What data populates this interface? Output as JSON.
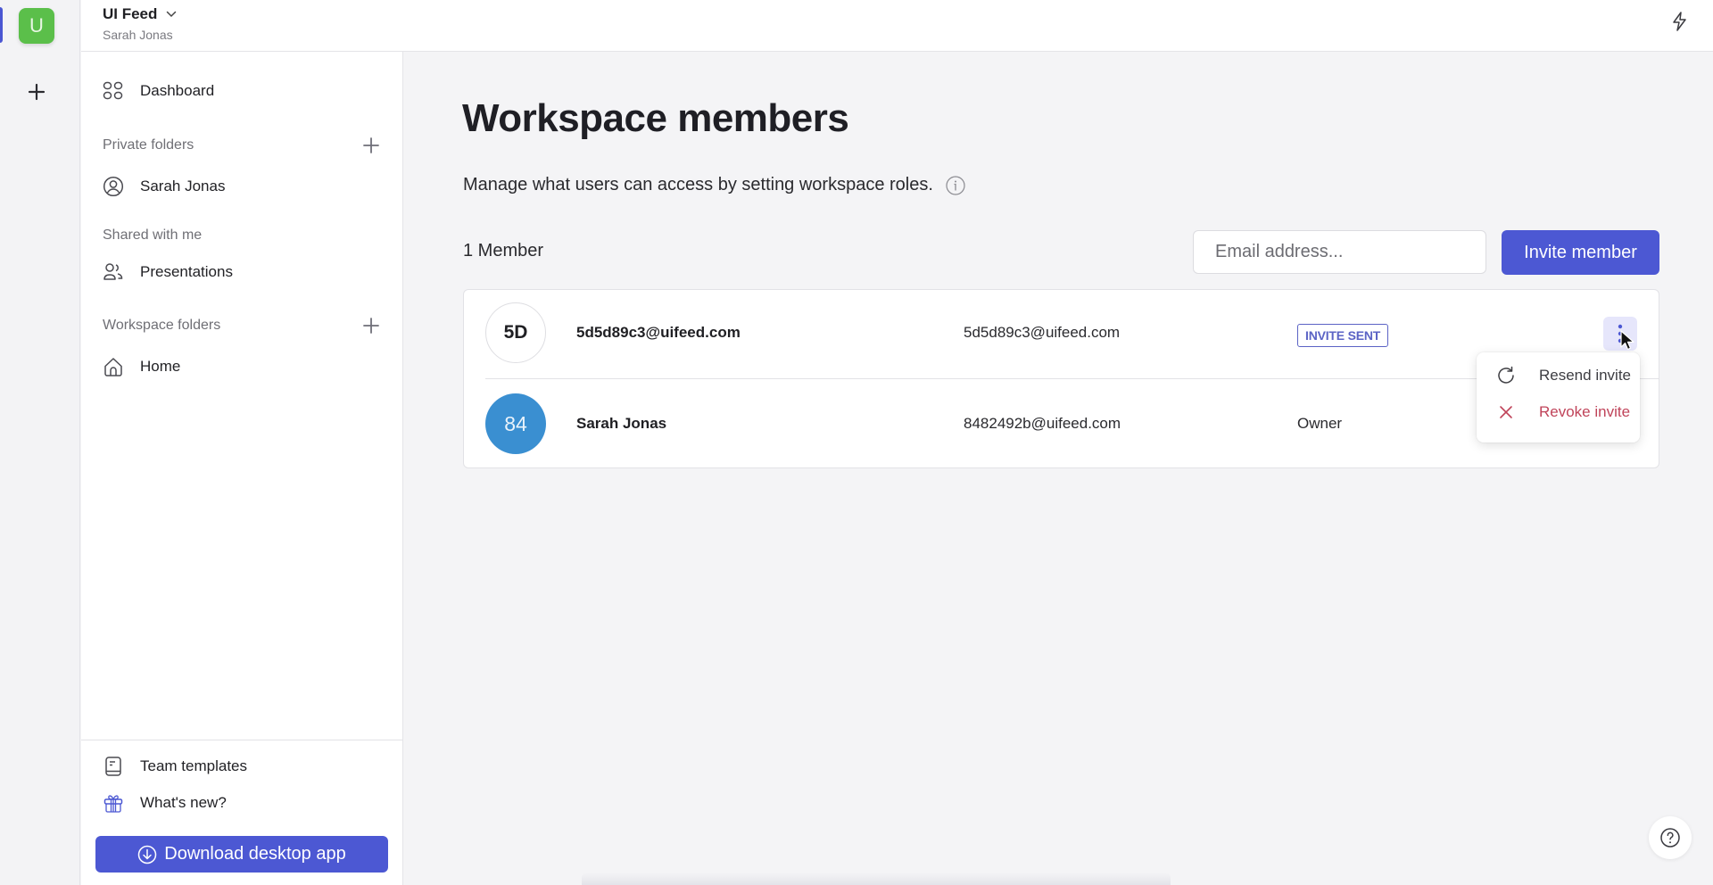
{
  "workspace": {
    "initial": "U",
    "name": "UI Feed",
    "owner": "Sarah Jonas",
    "badge_color": "#5bbf4a"
  },
  "rail": {
    "add_icon": "plus-icon"
  },
  "header": {
    "action_icon": "lightning-bolt-icon"
  },
  "sidebar": {
    "dashboard": {
      "label": "Dashboard",
      "icon": "grid-icon"
    },
    "sections": [
      {
        "label": "Private folders",
        "items": [
          {
            "label": "Sarah Jonas",
            "icon": "user-circle-icon"
          }
        ],
        "addable": true
      },
      {
        "label": "Shared with me",
        "items": [
          {
            "label": "Presentations",
            "icon": "users-icon"
          }
        ],
        "addable": false
      },
      {
        "label": "Workspace folders",
        "items": [
          {
            "label": "Home",
            "icon": "home-icon"
          }
        ],
        "addable": true
      }
    ],
    "footer": [
      {
        "label": "Team templates",
        "icon": "book-icon"
      },
      {
        "label": "What's new?",
        "icon": "gift-icon"
      }
    ],
    "download_label": "Download desktop app"
  },
  "main": {
    "title": "Workspace members",
    "description": "Manage what users can access by setting workspace roles.",
    "member_count": "1 Member",
    "email_placeholder": "Email address...",
    "email_value": "",
    "invite_label": "Invite member",
    "members": [
      {
        "avatar": "5D",
        "name": "5d5d89c3@uifeed.com",
        "email": "5d5d89c3@uifeed.com",
        "status": "INVITE SENT",
        "role": ""
      },
      {
        "avatar": "84",
        "name": "Sarah Jonas",
        "email": "8482492b@uifeed.com",
        "status": "",
        "role": "Owner",
        "avatar_color": "#3a8fd1"
      }
    ],
    "row_menu": {
      "items": [
        {
          "label": "Resend invite",
          "icon": "refresh-icon"
        },
        {
          "label": "Revoke invite",
          "icon": "close-icon",
          "color": "#c0445a"
        }
      ]
    }
  },
  "colors": {
    "accent": "#4c58d3",
    "danger": "#c0445a",
    "badge_outline": "#5b63c5"
  }
}
